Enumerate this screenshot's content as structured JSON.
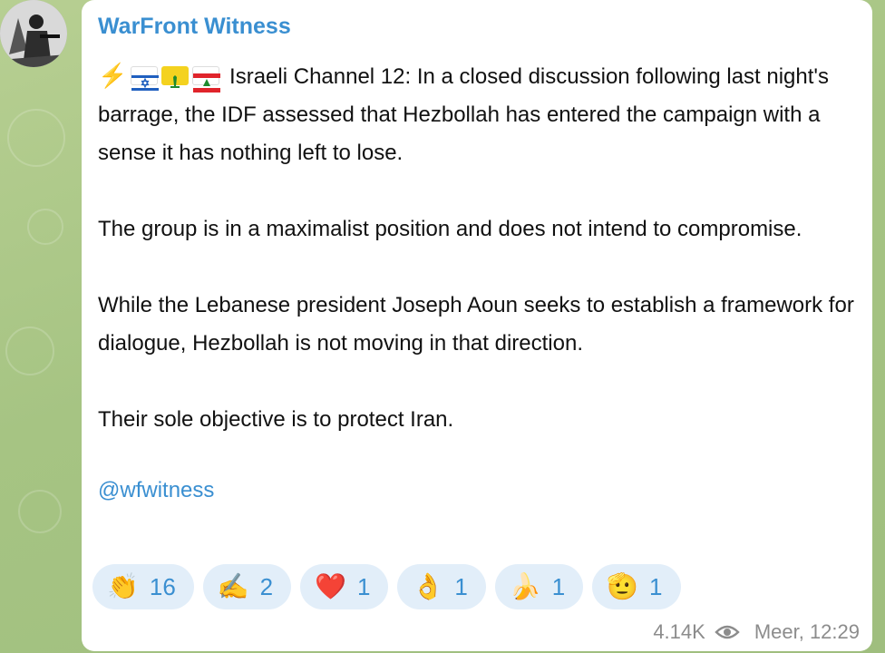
{
  "channel": {
    "name": "WarFront Witness"
  },
  "post": {
    "line1": "Israeli Channel 12: In a closed discussion following last night's barrage, the IDF assessed that Hezbollah has entered the campaign with a sense it has nothing left to lose.",
    "para2": "The group is in a maximalist position and does not intend to compromise.",
    "para3": "While the Lebanese president Joseph Aoun seeks to establish a framework for dialogue, Hezbollah is not moving in that direction.",
    "para4": "Their sole objective is to protect Iran.",
    "link": "@wfwitness"
  },
  "icons": [
    "lightning-icon",
    "israel-flag-icon",
    "hezbollah-flag-icon",
    "lebanon-flag-icon",
    "eye-icon"
  ],
  "reactions": [
    {
      "emoji": "👏",
      "name": "clapping-hands",
      "count": "16"
    },
    {
      "emoji": "✍️",
      "name": "writing-hand",
      "count": "2"
    },
    {
      "emoji": "❤️",
      "name": "red-heart",
      "count": "1"
    },
    {
      "emoji": "👌",
      "name": "ok-hand",
      "count": "1"
    },
    {
      "emoji": "🍌",
      "name": "banana",
      "count": "1"
    },
    {
      "emoji": "🫡",
      "name": "saluting-face",
      "count": "1"
    }
  ],
  "footer": {
    "views": "4.14K",
    "author_time": "Meer, 12:29"
  },
  "colors": {
    "accent": "#3a8fd1",
    "reaction_bg": "#e2eef9",
    "meta": "#8c8c8c"
  }
}
